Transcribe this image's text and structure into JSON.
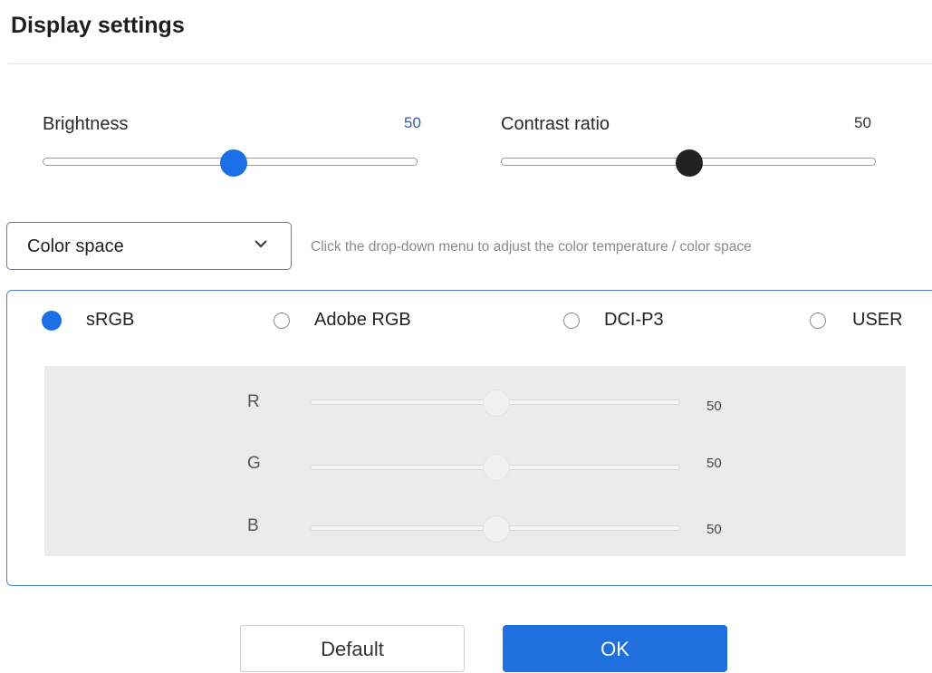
{
  "header": {
    "title": "Display settings"
  },
  "brightness": {
    "label": "Brightness",
    "value": "50",
    "level": 50
  },
  "contrast": {
    "label": "Contrast ratio",
    "value": "50",
    "level": 50
  },
  "color_space": {
    "selected": "Color space",
    "hint": "Click the drop-down menu to adjust the color temperature / color space"
  },
  "profiles": [
    {
      "label": "sRGB",
      "selected": true
    },
    {
      "label": "Adobe RGB",
      "selected": false
    },
    {
      "label": "DCI-P3",
      "selected": false
    },
    {
      "label": "USER",
      "selected": false
    }
  ],
  "rgb": {
    "r": {
      "label": "R",
      "value": "50",
      "level": 50
    },
    "g": {
      "label": "G",
      "value": "50",
      "level": 50
    },
    "b": {
      "label": "B",
      "value": "50",
      "level": 50
    }
  },
  "buttons": {
    "default_label": "Default",
    "ok_label": "OK"
  },
  "colors": {
    "accent": "#1f6fdf",
    "brightness_knob": "#1b6fe6",
    "contrast_knob": "#222222",
    "brightness_value_text": "#2f5fa8",
    "panel_border": "#4a7fd4"
  }
}
